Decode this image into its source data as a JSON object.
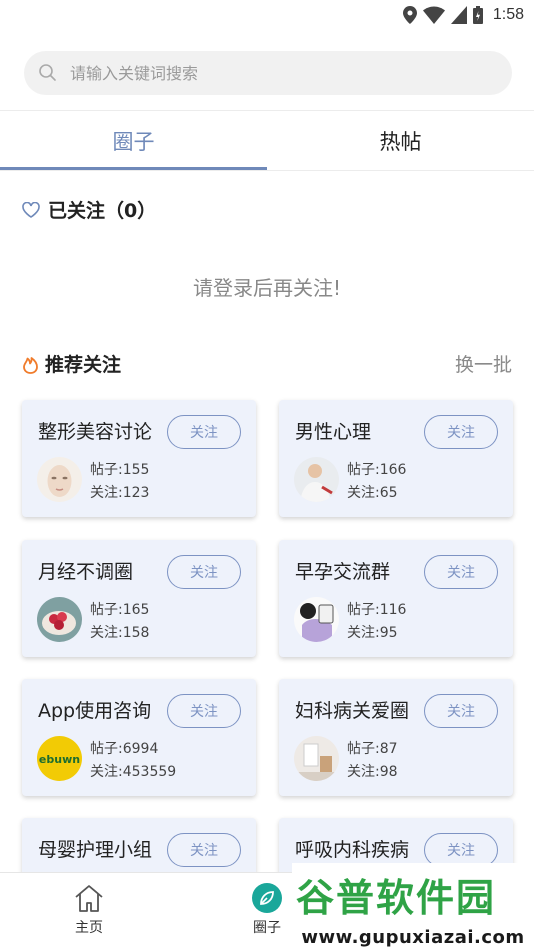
{
  "status_bar": {
    "time": "1:58"
  },
  "search": {
    "placeholder": "请输入关键词搜索"
  },
  "tabs": [
    {
      "label": "圈子",
      "active": true
    },
    {
      "label": "热帖",
      "active": false
    }
  ],
  "followed": {
    "title": "已关注（0）",
    "login_tip": "请登录后再关注!"
  },
  "recommend": {
    "title": "推荐关注",
    "refresh_label": "换一批"
  },
  "circles": [
    {
      "name": "整形美容讨论",
      "posts": "帖子:155",
      "follows": "关注:123",
      "button": "关注",
      "avatar": "face-avatar"
    },
    {
      "name": "男性心理",
      "posts": "帖子:166",
      "follows": "关注:65",
      "button": "关注",
      "avatar": "man-avatar"
    },
    {
      "name": "月经不调圈",
      "posts": "帖子:165",
      "follows": "关注:158",
      "button": "关注",
      "avatar": "food-avatar"
    },
    {
      "name": "早孕交流群",
      "posts": "帖子:116",
      "follows": "关注:95",
      "button": "关注",
      "avatar": "cartoon-avatar"
    },
    {
      "name": "App使用咨询",
      "posts": "帖子:6994",
      "follows": "关注:453559",
      "button": "关注",
      "avatar": "app-logo-avatar"
    },
    {
      "name": "妇科病关爱圈",
      "posts": "帖子:87",
      "follows": "关注:98",
      "button": "关注",
      "avatar": "room-avatar"
    },
    {
      "name": "母婴护理小组",
      "button": "关注"
    },
    {
      "name": "呼吸内科疾病",
      "button": "关注"
    }
  ],
  "bottom_nav": [
    {
      "label": "主页",
      "icon": "home-icon"
    },
    {
      "label": "圈子",
      "icon": "leaf-icon",
      "active": true
    }
  ],
  "watermark": {
    "main": "谷普软件园",
    "url": "www.gupuxiazai.com"
  },
  "colors": {
    "accent": "#6f89b9",
    "card_bg": "#eef2fb",
    "nav_active": "#1aa79a",
    "fire": "#f07c2c"
  }
}
